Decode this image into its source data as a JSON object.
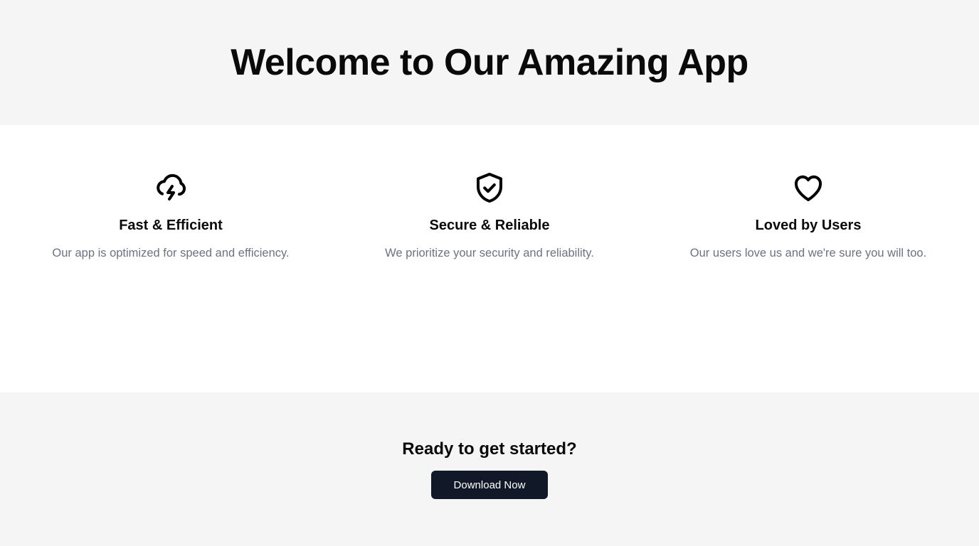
{
  "hero": {
    "title": "Welcome to Our Amazing App"
  },
  "features": [
    {
      "icon": "cloud-lightning-icon",
      "title": "Fast & Efficient",
      "description": "Our app is optimized for speed and efficiency."
    },
    {
      "icon": "shield-check-icon",
      "title": "Secure & Reliable",
      "description": "We prioritize your security and reliability."
    },
    {
      "icon": "heart-icon",
      "title": "Loved by Users",
      "description": "Our users love us and we're sure you will too."
    }
  ],
  "cta": {
    "heading": "Ready to get started?",
    "button_label": "Download Now"
  },
  "colors": {
    "section_gray": "#f5f5f5",
    "button_bg": "#111827",
    "muted_text": "#6b7280"
  }
}
